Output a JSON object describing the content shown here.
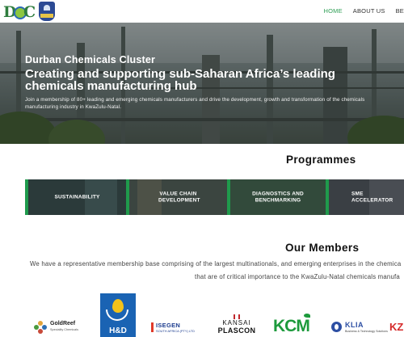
{
  "header": {
    "logo_letters": {
      "d": "D",
      "c": "C"
    },
    "nav": [
      {
        "label": "HOME",
        "active": true
      },
      {
        "label": "ABOUT US",
        "active": false
      },
      {
        "label": "BE",
        "active": false
      }
    ]
  },
  "hero": {
    "eyebrow": "Durban Chemicals Cluster",
    "headline": "Creating and supporting sub-Saharan Africa’s leading chemicals manufacturing hub",
    "subtext": "Join a membership of 80+ leading and emerging chemicals manufacturers and drive the development, growth and transformation of the chemicals manufacturing industry in KwaZulu-Natal."
  },
  "programmes": {
    "title": "Programmes",
    "cards": [
      {
        "label": "SUSTAINABILITY",
        "bg": "#2b3a3a"
      },
      {
        "label": "VALUE CHAIN DEVELOPMENT",
        "bg": "#3b4540"
      },
      {
        "label": "DIAGNOSTICS AND BENCHMARKING",
        "bg": "#2f3b35"
      },
      {
        "label": "SME ACCELERATOR",
        "bg": "#3a3f44"
      }
    ],
    "accent_color": "#1f9a4c"
  },
  "members": {
    "title": "Our Members",
    "line1": "We have a representative membership base comprising of the largest multinationals, and emerging enterprises in the chemica",
    "line2": "that are of critical importance to the KwaZulu-Natal chemicals manufa",
    "logos": {
      "goldreef": {
        "name": "GoldReef",
        "tagline": "Speciality Chemicals"
      },
      "hd": {
        "text": "H&D"
      },
      "isegen": {
        "name": "ISEGEN",
        "tagline": "SOUTH AFRICA (PTY) LTD"
      },
      "kansai": {
        "line1": "KANSAI",
        "line2": "PLASCON"
      },
      "kcm": {
        "text": "KCM"
      },
      "klia": {
        "name": "KLIA",
        "tagline": "Business & Technology Solutions"
      },
      "kz": {
        "text": "KZ"
      }
    }
  },
  "colors": {
    "nav_active": "#2f9e55",
    "brand_green": "#2f7d3e"
  }
}
